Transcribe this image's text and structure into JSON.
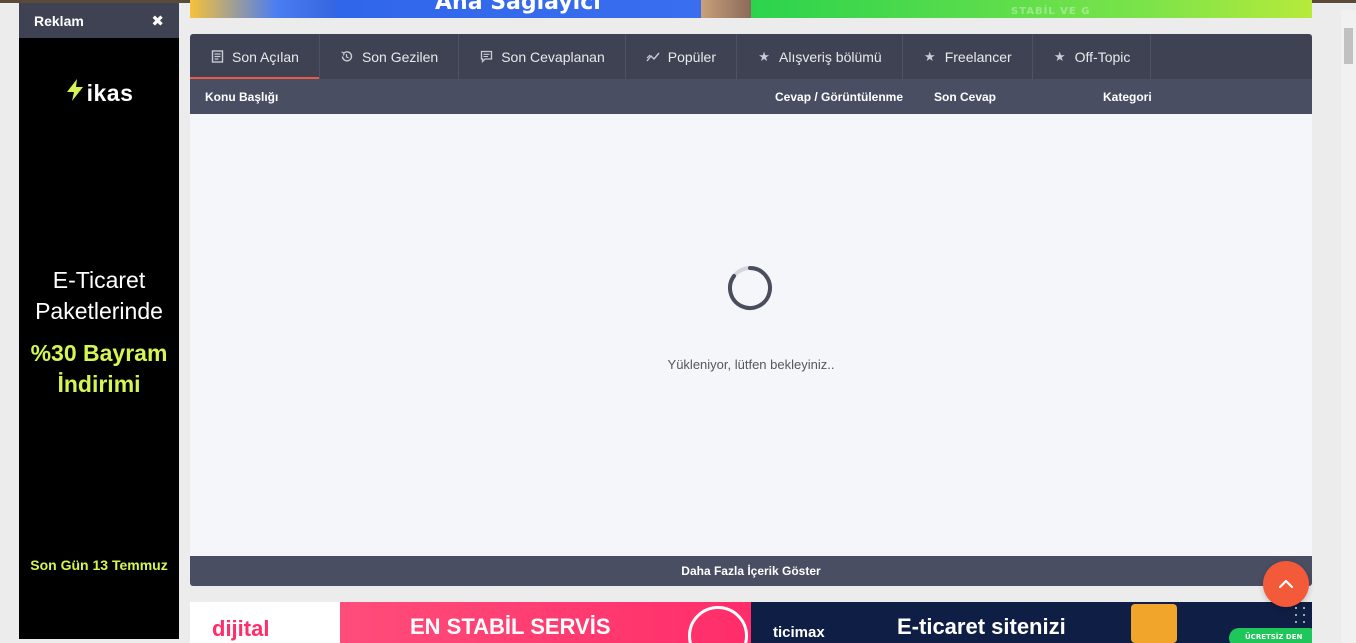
{
  "banners": {
    "top_left_text": "Ana Sağlayıcı",
    "top_right_text": "STABİL VE G",
    "bottom_left_brand": "dijital",
    "bottom_left_text": "EN STABİL SERVİS",
    "bottom_right_brand": "ticimax",
    "bottom_right_text": "E-ticaret sitenizi",
    "bottom_right_cta": "ÜCRETSİZ DEN"
  },
  "ad": {
    "title": "Reklam",
    "close": "✖",
    "brand": "ikas",
    "line1": "E-Ticaret",
    "line2": "Paketlerinde",
    "line3": "%30 Bayram",
    "line4": "İndirimi",
    "footer": "Son Gün 13 Temmuz",
    "accent_color": "#d6f553"
  },
  "tabs": [
    {
      "label": "Son Açılan",
      "icon": "document-icon",
      "active": true
    },
    {
      "label": "Son Gezilen",
      "icon": "history-icon",
      "active": false
    },
    {
      "label": "Son Cevaplanan",
      "icon": "comment-icon",
      "active": false
    },
    {
      "label": "Popüler",
      "icon": "trend-icon",
      "active": false
    },
    {
      "label": "Alışveriş bölümü",
      "icon": "star-icon",
      "active": false
    },
    {
      "label": "Freelancer",
      "icon": "star-icon",
      "active": false
    },
    {
      "label": "Off-Topic",
      "icon": "star-icon",
      "active": false
    }
  ],
  "columns": {
    "topic": "Konu Başlığı",
    "replies_views": "Cevap / Görüntülenme",
    "last_reply": "Son Cevap",
    "category": "Kategori"
  },
  "loading_text": "Yükleniyor, lütfen bekleyiniz..",
  "more_button": "Daha Fazla İçerik Göster",
  "colors": {
    "tab_bar": "#3e4252",
    "header_bar": "#4a4e62",
    "active_underline": "#e85c45",
    "to_top_button": "#f35a3a"
  }
}
